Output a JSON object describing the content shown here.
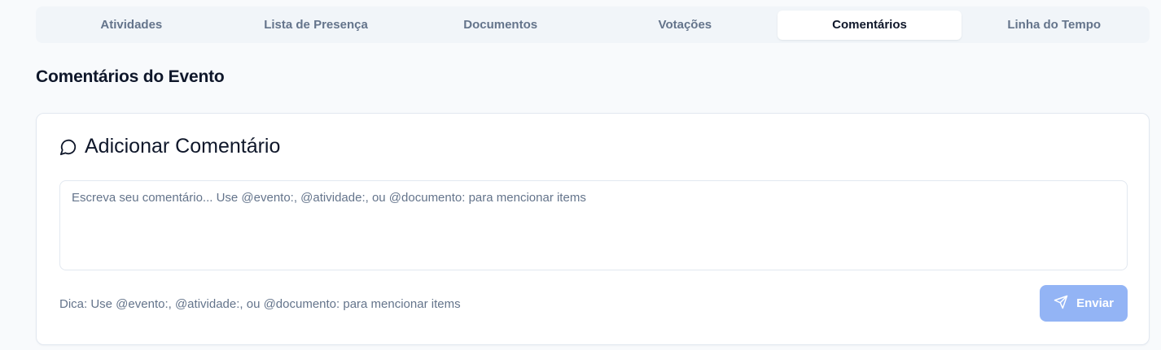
{
  "tabs": [
    {
      "label": "Atividades",
      "active": false
    },
    {
      "label": "Lista de Presença",
      "active": false
    },
    {
      "label": "Documentos",
      "active": false
    },
    {
      "label": "Votações",
      "active": false
    },
    {
      "label": "Comentários",
      "active": true
    },
    {
      "label": "Linha do Tempo",
      "active": false
    }
  ],
  "section": {
    "title": "Comentários do Evento"
  },
  "comment_form": {
    "icon": "message-circle-icon",
    "title": "Adicionar Comentário",
    "placeholder": "Escreva seu comentário... Use @evento:, @atividade:, ou @documento: para mencionar items",
    "value": "",
    "hint": "Dica: Use @evento:, @atividade:, ou @documento: para mencionar items",
    "send_label": "Enviar",
    "send_icon": "send-icon",
    "send_disabled": true
  },
  "colors": {
    "accent_disabled": "#93b4f5",
    "muted_text": "#64748b",
    "border": "#e2e8f0"
  }
}
